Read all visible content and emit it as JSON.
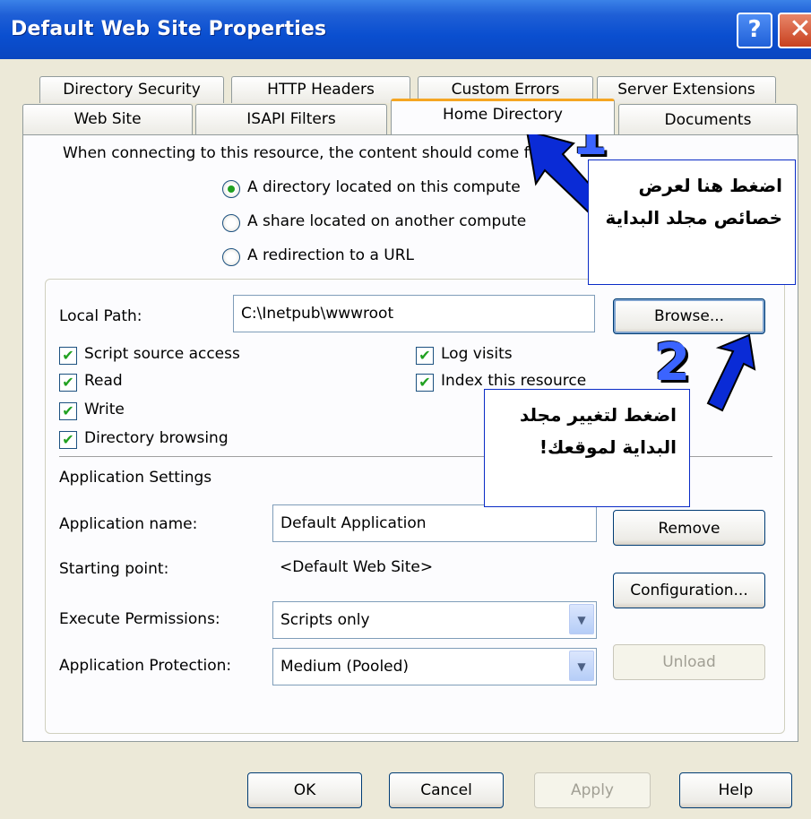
{
  "window": {
    "title": "Default Web Site Properties",
    "help_glyph": "?",
    "close_glyph": "✕"
  },
  "tabs": {
    "row1": [
      "Directory Security",
      "HTTP Headers",
      "Custom Errors",
      "Server Extensions"
    ],
    "row2": [
      "Web Site",
      "ISAPI Filters",
      "Home Directory",
      "Documents"
    ],
    "active": "Home Directory"
  },
  "content_source": {
    "prompt": "When connecting to this resource, the content should come fr",
    "options": [
      {
        "label": "A directory located on this compute",
        "checked": true
      },
      {
        "label": "A share located on another compute",
        "checked": false
      },
      {
        "label": "A redirection to a URL",
        "checked": false
      }
    ]
  },
  "local_path": {
    "label": "Local Path:",
    "value": "C:\\Inetpub\\wwwroot",
    "browse_label": "Browse..."
  },
  "permissions": {
    "script_source_access": "Script source access",
    "read": "Read",
    "write": "Write",
    "directory_browsing": "Directory browsing",
    "log_visits": "Log visits",
    "index_resource": "Index this resource",
    "checkmark": "✔"
  },
  "app_settings": {
    "heading": "Application Settings",
    "name_label": "Application name:",
    "name_value": "Default Application",
    "remove_label": "Remove",
    "starting_point_label": "Starting point:",
    "starting_point_value": "<Default Web Site>",
    "configuration_label": "Configuration...",
    "execute_label": "Execute Permissions:",
    "execute_value": "Scripts only",
    "protection_label": "Application Protection:",
    "protection_value": "Medium (Pooled)",
    "unload_label": "Unload",
    "dropdown_glyph": "▼"
  },
  "footer": {
    "ok": "OK",
    "cancel": "Cancel",
    "apply": "Apply",
    "help": "Help"
  },
  "annotations": {
    "callout1": "اضغط هنا لعرض خصائص مجلد البداية",
    "callout2": "اضغط لتغيير مجلد البداية لموقعك!",
    "badge1": "1",
    "badge2": "2",
    "arrow_color": "#0a2bd6"
  }
}
